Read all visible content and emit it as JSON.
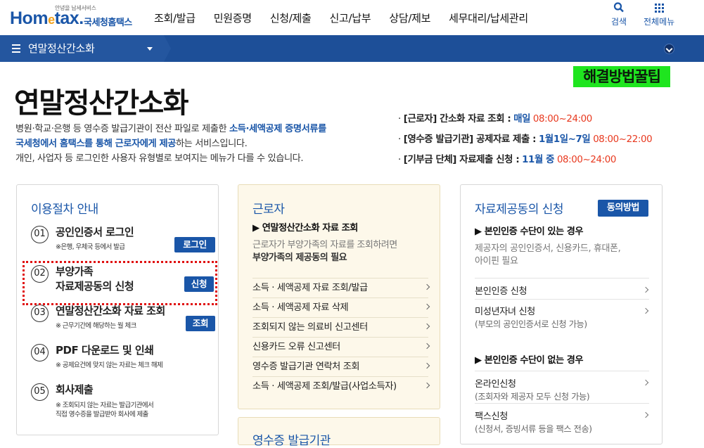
{
  "header": {
    "logo_small": "안녕을 납세서비스",
    "logo_home": "Hom",
    "logo_e": "e",
    "logo_tax": "tax.",
    "logo_ko": "국세청홈택스",
    "nav": [
      "조회/발급",
      "민원증명",
      "신청/제출",
      "신고/납부",
      "상담/제보",
      "세무대리/납세관리"
    ],
    "search_label": "검색",
    "allmenu_label": "전체메뉴",
    "brand_color": "#1a56a8"
  },
  "subbar": {
    "title": "연말정산간소화",
    "bg_color": "#1d4f98"
  },
  "watermark": "해결방법꿀팁",
  "page": {
    "title": "연말정산간소화",
    "intro_line1_a": "병원·학교·은행 등 영수증 발급기관이 전산 파일로 제출한 ",
    "intro_line1_b": "소득·세액공제 증명서류를",
    "intro_line2_a": "국세청에서 홈택스를 통해 근로자에게 제공",
    "intro_line2_b": "하는 서비스입니다.",
    "intro_line3": "개인, 사업자 등 로그인한 사용자 유형별로 보여지는 메뉴가 다를 수 있습니다."
  },
  "hours": [
    {
      "label": "[근로자] 간소화 자료 조회 :",
      "period": "매일",
      "time": "08:00~24:00"
    },
    {
      "label": "[영수증 발급기관] 공제자료 제출 :",
      "period": "1월1일~7일",
      "time": "08:00~22:00"
    },
    {
      "label": "[기부금 단체] 자료제출 신청 :",
      "period": "11월 중",
      "time": "08:00~24:00"
    }
  ],
  "procedure": {
    "title": "이용절차 안내",
    "steps": [
      {
        "num": "01",
        "title": "공인인증서 로그인",
        "note": "※은행, 우체국 등에서 발급",
        "button": "로그인"
      },
      {
        "num": "02",
        "title": "부양가족",
        "title2": "자료제공동의 신청",
        "note": "",
        "button": "신청"
      },
      {
        "num": "03",
        "title": "연말정산간소화 자료 조회",
        "note": "※ 근무기간에 해당하는 월 체크",
        "button": "조회"
      },
      {
        "num": "04",
        "title": "PDF 다운로드 및 인쇄",
        "note": "※ 공제요건에 맞지 않는 자료는 체크 해제",
        "button": ""
      },
      {
        "num": "05",
        "title": "회사제출",
        "note": "※ 조회되지 않는 자료는 발급기관에서",
        "note2": "직접 영수증을 발급받아 회사에 제출",
        "button": ""
      }
    ]
  },
  "worker": {
    "title": "근로자",
    "head": "▶ 연말정산간소화 자료 조회",
    "desc1": "근로자가 부양가족의 자료를 조회하려면",
    "desc2": "부양가족의 제공동의 필요",
    "links": [
      "소득 · 세액공제 자료 조회/발급",
      "소득 · 세액공제 자료 삭제",
      "조회되지 않는 의료비 신고센터",
      "신용카드 오류 신고센터",
      "영수증 발급기관 연락처 조회",
      "소득 · 세액공제 조회/발급(사업소득자)"
    ]
  },
  "card2b": {
    "title": "영수증 발급기관"
  },
  "consent": {
    "title": "자료제공동의 신청",
    "button": "동의방법",
    "sec1": "▶ 본인인증 수단이 있는 경우",
    "sec1_desc1": "제공자의 공인인증서, 신용카드, 휴대폰,",
    "sec1_desc2": "아이핀 필요",
    "links1": [
      {
        "label": "본인인증 신청",
        "sub": ""
      },
      {
        "label": "미성년자녀 신청",
        "sub": "(부모의 공인인증서로 신청 가능)"
      }
    ],
    "sec2": "▶ 본인인증 수단이 없는 경우",
    "links2": [
      {
        "label": "온라인신청",
        "sub": "(조회자와 제공자 모두 신청 가능)"
      },
      {
        "label": "팩스신청",
        "sub": "(신청서, 증빙서류 등을 팩스 전송)"
      }
    ]
  }
}
